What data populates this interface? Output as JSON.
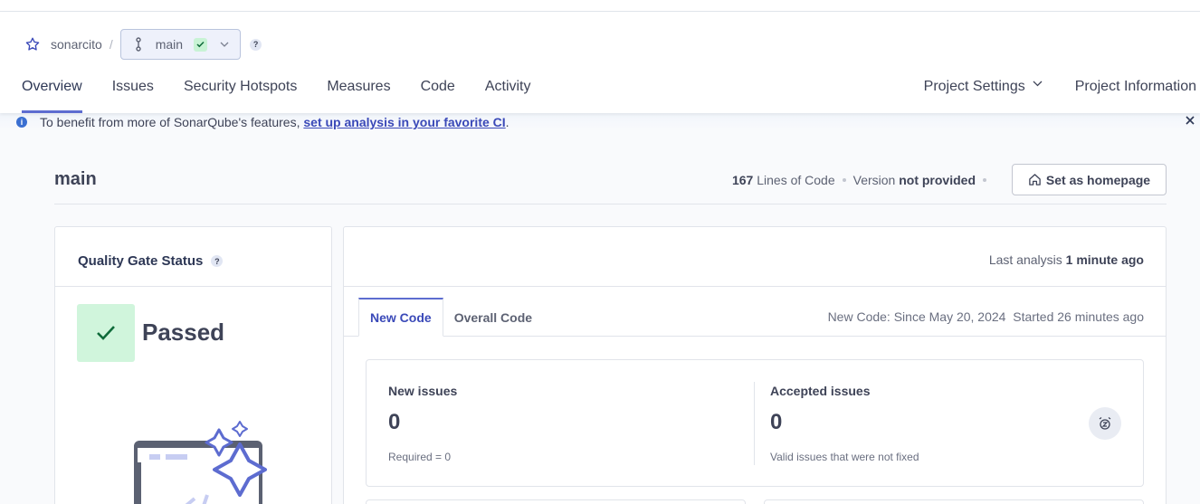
{
  "breadcrumb": {
    "project": "sonarcito",
    "separator": "/",
    "branch": "main",
    "help": "?"
  },
  "nav": {
    "tabs": [
      "Overview",
      "Issues",
      "Security Hotspots",
      "Measures",
      "Code",
      "Activity"
    ],
    "active": "Overview",
    "project_settings": "Project Settings",
    "project_information": "Project Information"
  },
  "banner": {
    "text_before": "To benefit from more of SonarQube's features, ",
    "link": "set up analysis in your favorite CI",
    "text_after": "."
  },
  "title": {
    "branch_name": "main",
    "loc_value": "167",
    "loc_label": "Lines of Code",
    "version_label": "Version",
    "version_value": "not provided",
    "homepage_button": "Set as homepage"
  },
  "quality_gate": {
    "title": "Quality Gate Status",
    "help": "?",
    "status": "Passed"
  },
  "analysis": {
    "last_analysis_label": "Last analysis",
    "last_analysis_value": "1 minute ago",
    "tab_new_code": "New Code",
    "tab_overall_code": "Overall Code",
    "new_code_since": "New Code: Since May 20, 2024",
    "started": "Started 26 minutes ago"
  },
  "issues": {
    "new_label": "New issues",
    "new_value": "0",
    "new_sub": "Required = 0",
    "accepted_label": "Accepted issues",
    "accepted_value": "0",
    "accepted_sub": "Valid issues that were not fixed"
  },
  "colors": {
    "accent": "#5d6cd0",
    "link": "#3a49b8",
    "passed_bg": "#d0f5dc",
    "passed_check": "#0f6b3a"
  }
}
